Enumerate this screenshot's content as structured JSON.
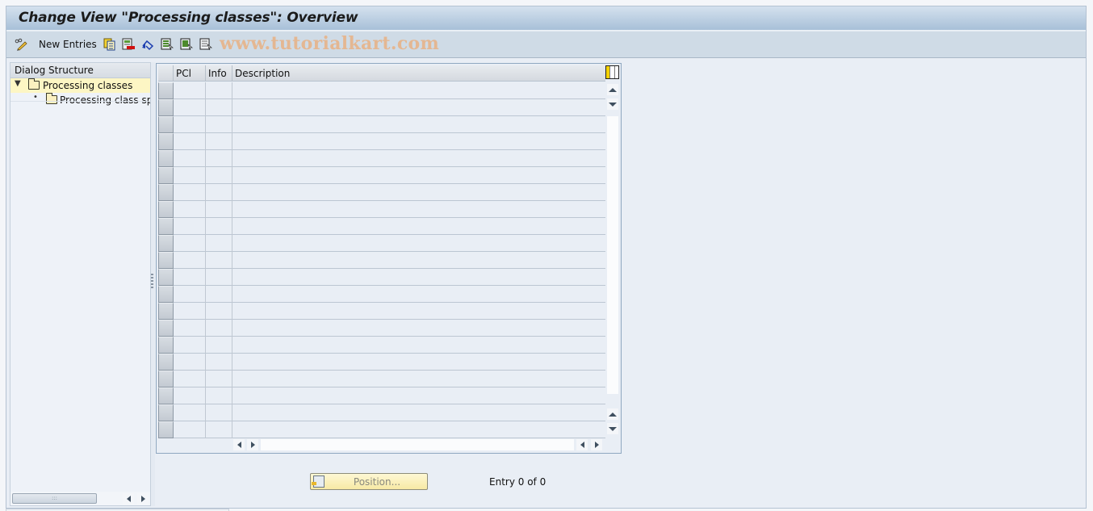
{
  "window": {
    "title": "Change View \"Processing classes\": Overview"
  },
  "toolbar": {
    "buttons": [
      {
        "name": "change-display-toggle",
        "icon": "pencil-glasses-icon",
        "label": ""
      },
      {
        "name": "new-entries",
        "icon": "",
        "label": "New Entries"
      },
      {
        "name": "copy-as",
        "icon": "copy-icon",
        "label": ""
      },
      {
        "name": "delete",
        "icon": "delete-icon",
        "label": ""
      },
      {
        "name": "undo-change",
        "icon": "undo-icon",
        "label": ""
      },
      {
        "name": "select-all",
        "icon": "select-all-icon",
        "label": ""
      },
      {
        "name": "select-block",
        "icon": "select-block-icon",
        "label": ""
      },
      {
        "name": "deselect-all",
        "icon": "deselect-all-icon",
        "label": ""
      }
    ],
    "watermark": "www.tutorialkart.com"
  },
  "dialog_structure": {
    "header": "Dialog Structure",
    "items": [
      {
        "label": "Processing classes",
        "level": 0,
        "expanded": true,
        "selected": true
      },
      {
        "label": "Processing class spec",
        "level": 1,
        "expanded": false,
        "selected": false
      }
    ]
  },
  "table": {
    "columns": [
      {
        "key": "pcl",
        "label": "PCl"
      },
      {
        "key": "info",
        "label": "Info"
      },
      {
        "key": "description",
        "label": "Description"
      }
    ],
    "rows": [],
    "visible_empty_rows": 21
  },
  "footer": {
    "position_button": "Position...",
    "entry_text": "Entry 0 of 0"
  },
  "colors": {
    "title_gradient_top": "#d4e1ee",
    "title_gradient_bottom": "#a8c0d8",
    "selected_tree_item": "#fdf6c4",
    "watermark": "#e7b48a",
    "position_button": "#f7e9a4"
  }
}
